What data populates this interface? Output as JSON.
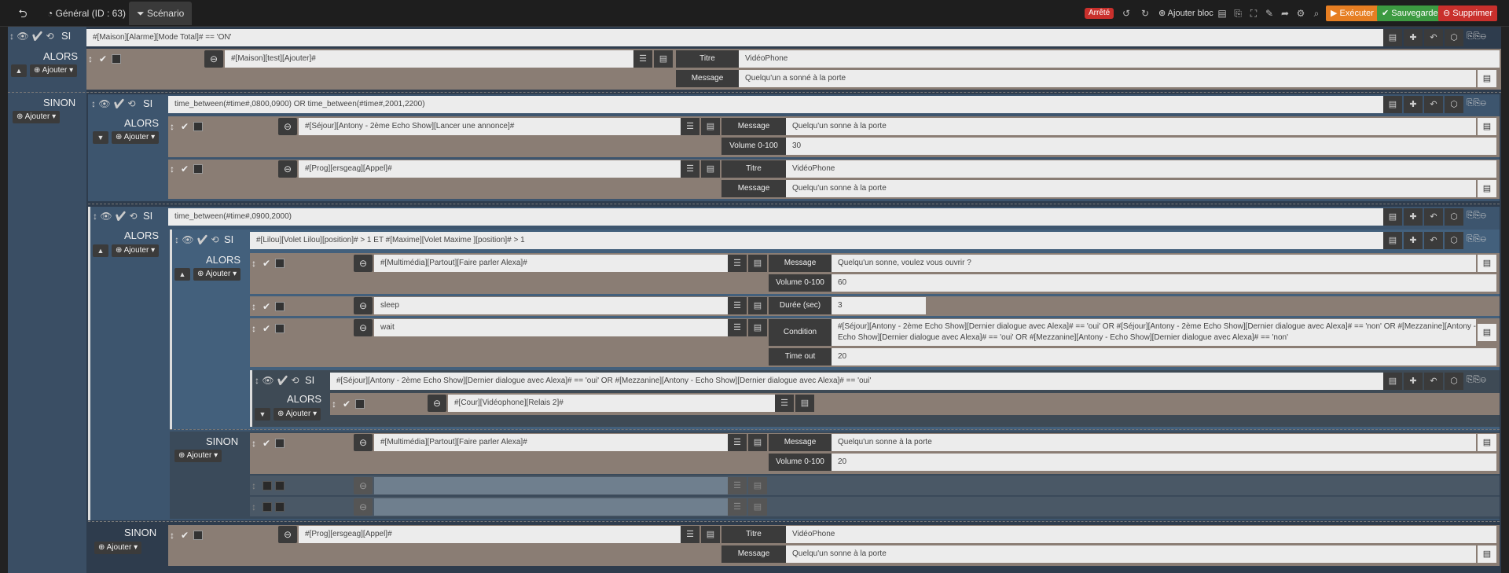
{
  "topbar": {
    "tab_general": "Général (ID : 63)",
    "tab_scenario": "Scénario",
    "status": "Arrêté",
    "add_block": "Ajouter bloc",
    "execute": "Exécuter",
    "save": "Sauvegarder",
    "delete": "Supprimer",
    "colors": {
      "execute": "#e67e22",
      "save": "#3c9a41",
      "delete": "#c9302c",
      "status": "#c9302c"
    }
  },
  "kw": {
    "si": "SI",
    "alors": "ALORS",
    "sinon": "SINON",
    "add": "Ajouter"
  },
  "block1": {
    "condition": "#[Maison][Alarme][Mode Total]# == 'ON'",
    "action": "#[Maison][test][Ajouter]#",
    "titre_label": "Titre",
    "titre": "VidéoPhone",
    "message_label": "Message",
    "message": "Quelqu'un a sonné à la porte"
  },
  "block2": {
    "condition": "time_between(#time#,0800,0900) OR time_between(#time#,2001,2200)",
    "action1": "#[Séjour][Antony - 2ème Echo Show][Lancer une annonce]#",
    "message_label": "Message",
    "message1": "Quelqu'un sonne à la porte",
    "volume_label": "Volume 0-100",
    "volume1": "30",
    "action2": "#[Prog][ersgeag][Appel]#",
    "titre_label": "Titre",
    "titre2": "VidéoPhone",
    "message2": "Quelqu'un sonne à la porte"
  },
  "block3": {
    "condition": "time_between(#time#,0900,2000)",
    "inner_condition": "#[Lilou][Volet Lilou][position]# > 1  ET #[Maxime][Volet Maxime ][position]# > 1",
    "action1": "#[Multimédia][Partout][Faire parler Alexa]#",
    "message_label": "Message",
    "message1": "Quelqu'un sonne, voulez vous ouvrir ?",
    "volume_label": "Volume 0-100",
    "volume1": "60",
    "action2": "sleep",
    "duree_label": "Durée (sec)",
    "duree": "3",
    "action3": "wait",
    "condition_label": "Condition",
    "wait_condition": "#[Séjour][Antony - 2ème Echo Show][Dernier dialogue avec Alexa]# == 'oui' OR #[Séjour][Antony - 2ème Echo Show][Dernier dialogue avec Alexa]# == 'non' OR #[Mezzanine][Antony - Echo Show][Dernier dialogue avec Alexa]# == 'oui' OR #[Mezzanine][Antony - Echo Show][Dernier dialogue avec Alexa]# == 'non'",
    "timeout_label": "Time out",
    "timeout": "20",
    "nested_condition": "#[Séjour][Antony - 2ème Echo Show][Dernier dialogue avec Alexa]# == 'oui' OR #[Mezzanine][Antony - Echo Show][Dernier dialogue avec Alexa]# == 'oui'",
    "nested_action": "#[Cour][Vidéophone][Relais 2]#",
    "sinon_action": "#[Multimédia][Partout][Faire parler Alexa]#",
    "sinon_message": "Quelqu'un sonne à la porte",
    "sinon_volume": "20"
  },
  "block4": {
    "action": "#[Prog][ersgeag][Appel]#",
    "titre_label": "Titre",
    "titre": "VidéoPhone",
    "message_label": "Message",
    "message": "Quelqu'un sonne à la porte"
  }
}
